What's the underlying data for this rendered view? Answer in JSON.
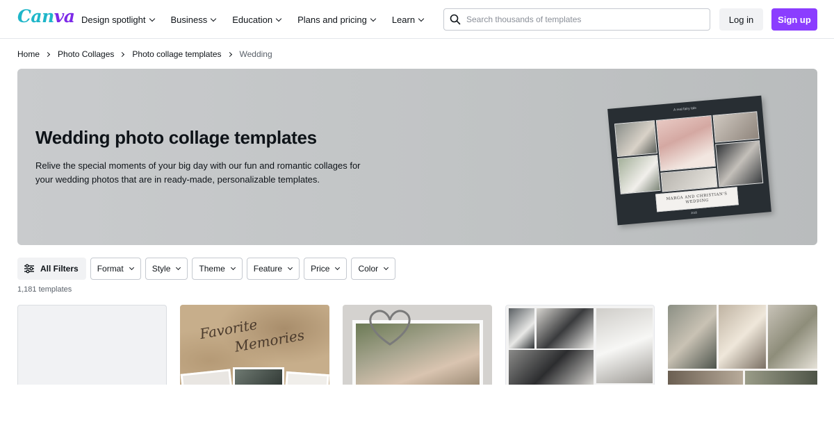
{
  "header": {
    "logo": {
      "primary": "Can",
      "accent": "va"
    },
    "nav": [
      {
        "label": "Design spotlight"
      },
      {
        "label": "Business"
      },
      {
        "label": "Education"
      },
      {
        "label": "Plans and pricing"
      },
      {
        "label": "Learn"
      }
    ],
    "search": {
      "placeholder": "Search thousands of templates",
      "value": ""
    },
    "login_label": "Log in",
    "signup_label": "Sign up"
  },
  "breadcrumb": [
    {
      "label": "Home"
    },
    {
      "label": "Photo Collages"
    },
    {
      "label": "Photo collage templates"
    },
    {
      "label": "Wedding"
    }
  ],
  "hero": {
    "title": "Wedding photo collage templates",
    "description": "Relive the special moments of your big day with our fun and romantic collages for your wedding photos that are in ready-made, personalizable templates.",
    "card": {
      "top_text": "A real fairy tale",
      "banner_text": "MARGA AND CHRISTIAN'S WEDDING",
      "bottom_text": "2025"
    }
  },
  "filters": {
    "all_label": "All Filters",
    "items": [
      {
        "label": "Format"
      },
      {
        "label": "Style"
      },
      {
        "label": "Theme"
      },
      {
        "label": "Feature"
      },
      {
        "label": "Price"
      },
      {
        "label": "Color"
      }
    ]
  },
  "results_count": "1,181 templates",
  "templates": {
    "card2_text": {
      "line1": "Favorite",
      "line2": "Memories"
    }
  },
  "colors": {
    "accent": "#8b3dff",
    "logo_teal": "#1fb6c9",
    "logo_purple": "#7d2ae8",
    "text": "#0e1318",
    "border": "#c5c9d0"
  }
}
